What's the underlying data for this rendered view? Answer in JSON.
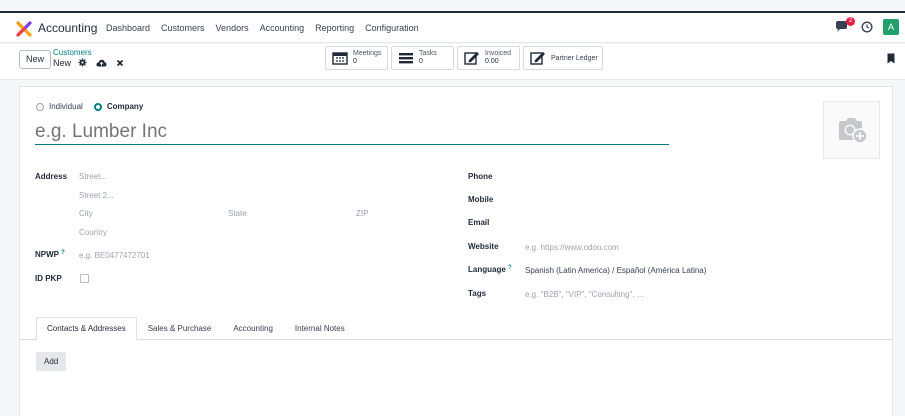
{
  "nav": {
    "app_name": "Accounting",
    "menu": [
      "Dashboard",
      "Customers",
      "Vendors",
      "Accounting",
      "Reporting",
      "Configuration"
    ],
    "chat_badge": "2",
    "avatar_letter": "A"
  },
  "control": {
    "new_button": "New",
    "breadcrumb_parent": "Customers",
    "breadcrumb_current": "New",
    "smart_buttons": {
      "meetings_label": "Meetings",
      "meetings_value": "0",
      "tasks_label": "Tasks",
      "tasks_value": "0",
      "invoiced_label": "Invoiced",
      "invoiced_value": "0.00",
      "ledger_label": "Partner Ledger"
    }
  },
  "form": {
    "type_individual": "Individual",
    "type_company": "Company",
    "type_selected": "Company",
    "name_placeholder": "e.g. Lumber Inc",
    "address_label": "Address",
    "street_placeholder": "Street...",
    "street2_placeholder": "Street 2...",
    "city_placeholder": "City",
    "state_placeholder": "State",
    "zip_placeholder": "ZIP",
    "country_placeholder": "Country",
    "npwp_label": "NPWP",
    "npwp_help": "?",
    "npwp_placeholder": "e.g. BE0477472701",
    "idpkp_label": "ID PKP",
    "phone_label": "Phone",
    "mobile_label": "Mobile",
    "email_label": "Email",
    "website_label": "Website",
    "website_placeholder": "e.g. https://www.odoo.com",
    "language_label": "Language",
    "language_help": "?",
    "language_value": "Spanish (Latin America) / Español (América Latina)",
    "tags_label": "Tags",
    "tags_placeholder": "e.g. \"B2B\", \"VIP\", \"Consulting\", ..."
  },
  "tabs": [
    "Contacts & Addresses",
    "Sales & Purchase",
    "Accounting",
    "Internal Notes"
  ],
  "add_button": "Add",
  "colors": {
    "accent": "#017e84",
    "badge": "#e11d48",
    "avatar": "#22a06b"
  }
}
